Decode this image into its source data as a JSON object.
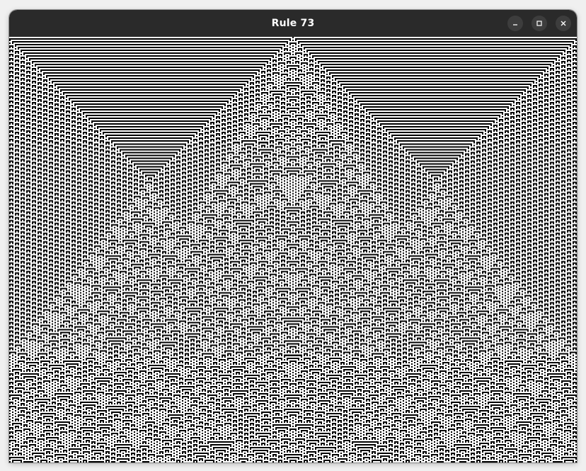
{
  "window": {
    "title": "Rule 73",
    "controls": [
      {
        "name": "minimize-button",
        "icon": "minimize-icon"
      },
      {
        "name": "maximize-button",
        "icon": "maximize-icon"
      },
      {
        "name": "close-button",
        "icon": "close-icon"
      }
    ]
  },
  "automaton": {
    "rule": 73,
    "initial_condition": "single-center-cell",
    "colors": {
      "alive": "#000000",
      "dead": "#ffffff",
      "titlebar": "#2a2a2a",
      "button": "#3d3d3d"
    }
  }
}
